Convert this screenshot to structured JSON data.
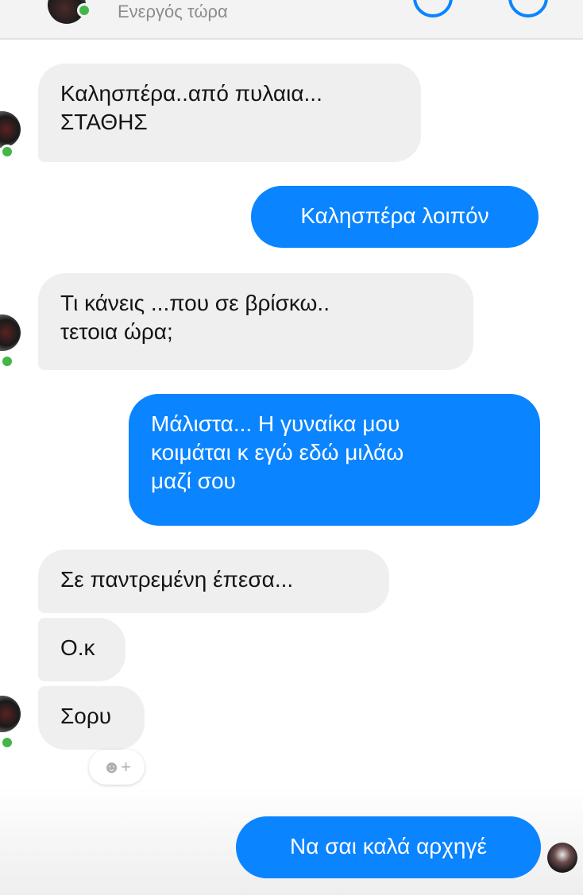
{
  "header": {
    "status": "Ενεργός τώρα",
    "avatar_icon": "contact-avatar",
    "call_icon": "phone-icon",
    "video_icon": "video-camera-icon"
  },
  "messages": [
    {
      "direction": "incoming",
      "lines": [
        "Καλησπέρα..από πυλαια...",
        "ΣΤΑΘΗΣ"
      ]
    },
    {
      "direction": "outgoing",
      "lines": [
        "Καλησπέρα λοιπόν"
      ]
    },
    {
      "direction": "incoming",
      "lines": [
        "Τι κάνεις ...που σε βρίσκω..",
        "τετοια ώρα;"
      ]
    },
    {
      "direction": "outgoing",
      "lines": [
        "Μάλιστα... Η γυναίκα μου",
        "κοιμάται κ εγώ εδώ μιλάω",
        "μαζί σου"
      ]
    },
    {
      "direction": "incoming",
      "lines": [
        "Σε παντρεμένη έπεσα..."
      ]
    },
    {
      "direction": "incoming",
      "lines": [
        "Ο.κ"
      ]
    },
    {
      "direction": "incoming",
      "lines": [
        "Σορυ"
      ]
    },
    {
      "direction": "outgoing",
      "lines": [
        "Να σαι καλά αρχηγέ"
      ]
    }
  ],
  "reaction_button": {
    "icon": "smiley-add-icon",
    "label": "☻+"
  },
  "colors": {
    "outgoing_bubble": "#0a84ff",
    "incoming_bubble": "#efefef",
    "online": "#44b549",
    "header_bg": "#f3f3f3"
  }
}
